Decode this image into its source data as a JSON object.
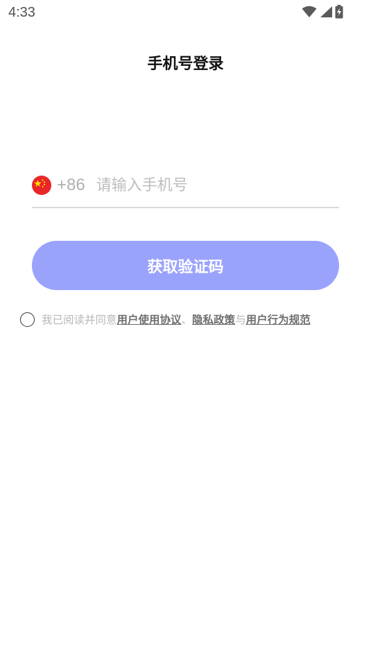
{
  "status_bar": {
    "time": "4:33",
    "icons": [
      "wifi-icon",
      "signal-icon",
      "battery-charging-icon"
    ]
  },
  "header": {
    "title": "手机号登录"
  },
  "login": {
    "country_flag": "china-flag-icon",
    "country_code": "+86",
    "phone_placeholder": "请输入手机号",
    "phone_value": "",
    "get_code_label": "获取验证码",
    "button_color": "#9aa3fc"
  },
  "agreement": {
    "prefix": "我已阅读并同意",
    "user_agreement": "用户使用协议",
    "sep1": "、",
    "privacy_policy": "隐私政策",
    "sep2": "与",
    "conduct_rules": "用户行为规范",
    "checked": false
  }
}
